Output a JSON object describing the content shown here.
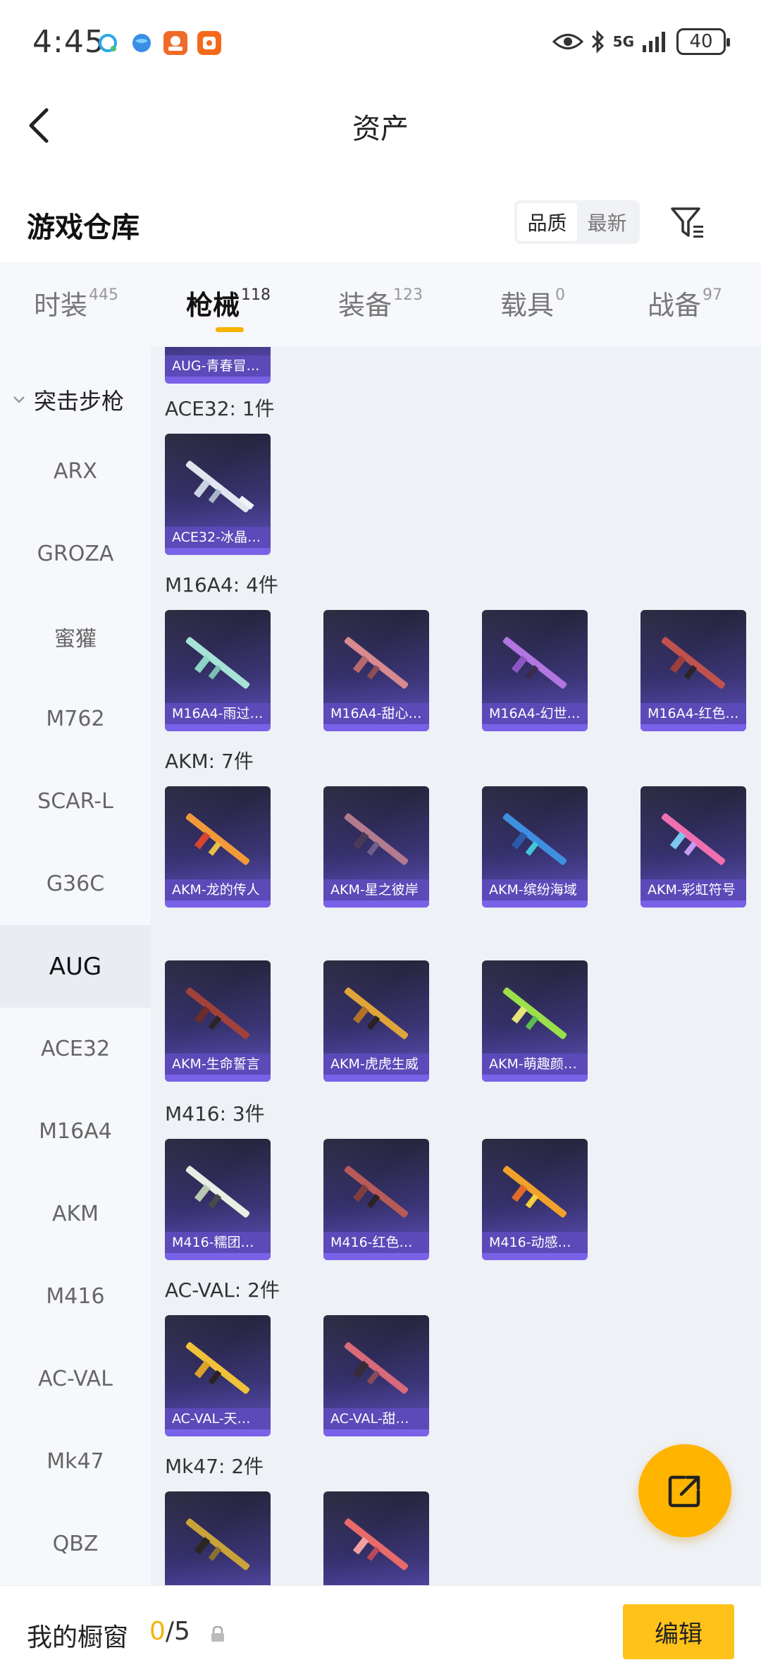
{
  "status_bar": {
    "time": "4:45",
    "network": "5G",
    "battery": "40"
  },
  "header": {
    "title": "资产"
  },
  "warehouse": {
    "title": "游戏仓库",
    "sort_options": [
      "品质",
      "最新"
    ]
  },
  "tabs": [
    {
      "label": "时装",
      "count": "445"
    },
    {
      "label": "枪械",
      "count": "118"
    },
    {
      "label": "装备",
      "count": "123"
    },
    {
      "label": "载具",
      "count": "0"
    },
    {
      "label": "战备",
      "count": "97"
    }
  ],
  "sidebar": {
    "category": "突击步枪",
    "items": [
      "ARX",
      "GROZA",
      "蜜獾",
      "M762",
      "SCAR-L",
      "G36C",
      "AUG",
      "ACE32",
      "M16A4",
      "AKM",
      "M416",
      "AC-VAL",
      "Mk47",
      "QBZ"
    ],
    "selected": "AUG"
  },
  "groups": [
    {
      "header": "",
      "items": [
        "AUG-青春冒…"
      ]
    },
    {
      "header": "ACE32: 1件",
      "items": [
        "ACE32-冰晶…"
      ]
    },
    {
      "header": "M16A4: 4件",
      "items": [
        "M16A4-雨过…",
        "M16A4-甜心…",
        "M16A4-幻世…",
        "M16A4-红色…"
      ]
    },
    {
      "header": "AKM: 7件",
      "items": [
        "AKM-龙的传人",
        "AKM-星之彼岸",
        "AKM-缤纷海域",
        "AKM-彩虹符号",
        "AKM-生命誓言",
        "AKM-虎虎生威",
        "AKM-萌趣颜…"
      ]
    },
    {
      "header": "M416: 3件",
      "items": [
        "M416-糯团…",
        "M416-红色…",
        "M416-动感…"
      ]
    },
    {
      "header": "AC-VAL: 2件",
      "items": [
        "AC-VAL-天…",
        "AC-VAL-甜…"
      ]
    },
    {
      "header": "Mk47: 2件",
      "items": [
        "",
        ""
      ]
    }
  ],
  "bottom_bar": {
    "label": "我的橱窗",
    "count_current": "0",
    "count_total": "/5",
    "edit_label": "编辑"
  },
  "colors": {
    "accent": "#f5b300",
    "card_caption": "#5b4ab8"
  }
}
